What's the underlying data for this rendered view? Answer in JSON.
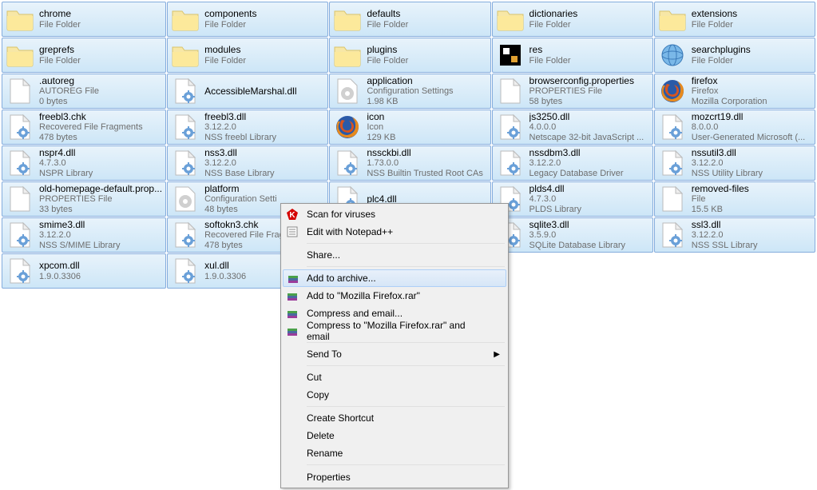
{
  "items": [
    {
      "icon": "folder",
      "name": "chrome",
      "line2": "File Folder",
      "line3": ""
    },
    {
      "icon": "folder",
      "name": "components",
      "line2": "File Folder",
      "line3": ""
    },
    {
      "icon": "folder",
      "name": "defaults",
      "line2": "File Folder",
      "line3": ""
    },
    {
      "icon": "folder",
      "name": "dictionaries",
      "line2": "File Folder",
      "line3": ""
    },
    {
      "icon": "folder",
      "name": "extensions",
      "line2": "File Folder",
      "line3": ""
    },
    {
      "icon": "folder",
      "name": "greprefs",
      "line2": "File Folder",
      "line3": ""
    },
    {
      "icon": "folder",
      "name": "modules",
      "line2": "File Folder",
      "line3": ""
    },
    {
      "icon": "folder",
      "name": "plugins",
      "line2": "File Folder",
      "line3": ""
    },
    {
      "icon": "res",
      "name": "res",
      "line2": "File Folder",
      "line3": ""
    },
    {
      "icon": "globe",
      "name": "searchplugins",
      "line2": "File Folder",
      "line3": ""
    },
    {
      "icon": "doc",
      "name": ".autoreg",
      "line2": "AUTOREG File",
      "line3": "0 bytes"
    },
    {
      "icon": "gear",
      "name": "AccessibleMarshal.dll",
      "line2": "",
      "line3": ""
    },
    {
      "icon": "conf",
      "name": "application",
      "line2": "Configuration Settings",
      "line3": "1.98 KB"
    },
    {
      "icon": "doc",
      "name": "browserconfig.properties",
      "line2": "PROPERTIES File",
      "line3": "58 bytes"
    },
    {
      "icon": "firefox",
      "name": "firefox",
      "line2": "Firefox",
      "line3": "Mozilla Corporation"
    },
    {
      "icon": "gear",
      "name": "freebl3.chk",
      "line2": "Recovered File Fragments",
      "line3": "478 bytes"
    },
    {
      "icon": "gear",
      "name": "freebl3.dll",
      "line2": "3.12.2.0",
      "line3": "NSS freebl Library"
    },
    {
      "icon": "firefox",
      "name": "icon",
      "line2": "Icon",
      "line3": "129 KB"
    },
    {
      "icon": "gear",
      "name": "js3250.dll",
      "line2": "4.0.0.0",
      "line3": "Netscape 32-bit JavaScript ..."
    },
    {
      "icon": "gear",
      "name": "mozcrt19.dll",
      "line2": "8.0.0.0",
      "line3": "User-Generated Microsoft (..."
    },
    {
      "icon": "gear",
      "name": "nspr4.dll",
      "line2": "4.7.3.0",
      "line3": "NSPR Library"
    },
    {
      "icon": "gear",
      "name": "nss3.dll",
      "line2": "3.12.2.0",
      "line3": "NSS Base Library"
    },
    {
      "icon": "gear",
      "name": "nssckbi.dll",
      "line2": "1.73.0.0",
      "line3": "NSS Builtin Trusted Root CAs"
    },
    {
      "icon": "gear",
      "name": "nssdbm3.dll",
      "line2": "3.12.2.0",
      "line3": "Legacy Database Driver"
    },
    {
      "icon": "gear",
      "name": "nssutil3.dll",
      "line2": "3.12.2.0",
      "line3": "NSS Utility Library"
    },
    {
      "icon": "doc",
      "name": "old-homepage-default.prop...",
      "line2": "PROPERTIES File",
      "line3": "33 bytes"
    },
    {
      "icon": "conf",
      "name": "platform",
      "line2": "Configuration Setti",
      "line3": "48 bytes"
    },
    {
      "icon": "gear",
      "name": "plc4.dll",
      "line2": "",
      "line3": ""
    },
    {
      "icon": "gear",
      "name": "plds4.dll",
      "line2": "4.7.3.0",
      "line3": "PLDS Library"
    },
    {
      "icon": "doc",
      "name": "removed-files",
      "line2": "File",
      "line3": "15.5 KB"
    },
    {
      "icon": "gear",
      "name": "smime3.dll",
      "line2": "3.12.2.0",
      "line3": "NSS S/MIME Library"
    },
    {
      "icon": "gear",
      "name": "softokn3.chk",
      "line2": "Recovered File Frag",
      "line3": "478 bytes"
    },
    {
      "icon": "",
      "name": "",
      "line2": "",
      "line3": ""
    },
    {
      "icon": "gear",
      "name": "sqlite3.dll",
      "line2": "3.5.9.0",
      "line3": "SQLite Database Library"
    },
    {
      "icon": "gear",
      "name": "ssl3.dll",
      "line2": "3.12.2.0",
      "line3": "NSS SSL Library"
    },
    {
      "icon": "gear",
      "name": "xpcom.dll",
      "line2": "1.9.0.3306",
      "line3": ""
    },
    {
      "icon": "gear",
      "name": "xul.dll",
      "line2": "1.9.0.3306",
      "line3": ""
    }
  ],
  "context_menu": {
    "scan": "Scan for viruses",
    "edit": "Edit with Notepad++",
    "share": "Share...",
    "add_archive": "Add to archive...",
    "add_rar": "Add to \"Mozilla Firefox.rar\"",
    "compress_email": "Compress and email...",
    "compress_rar_email": "Compress to \"Mozilla Firefox.rar\" and email",
    "sendto": "Send To",
    "cut": "Cut",
    "copy": "Copy",
    "shortcut": "Create Shortcut",
    "delete": "Delete",
    "rename": "Rename",
    "properties": "Properties"
  }
}
